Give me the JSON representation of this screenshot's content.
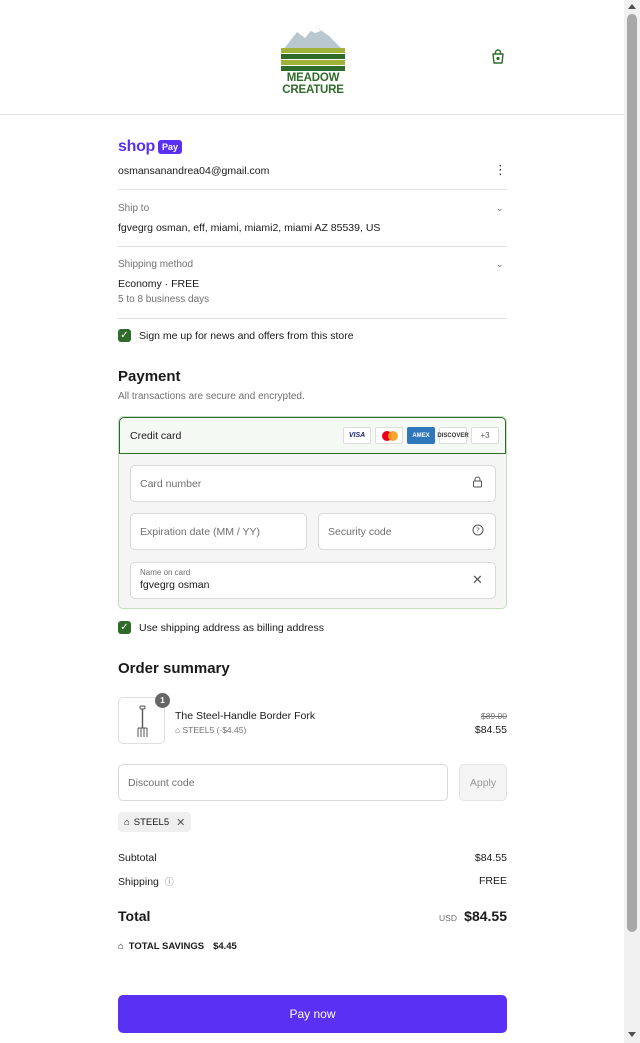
{
  "brand": {
    "name_line1": "MEADOW",
    "name_line2": "CREATURE",
    "logo_icon": "mountain-field-logo",
    "green": "#2f6b2a"
  },
  "header": {
    "cart_icon": "shopping-bag-icon"
  },
  "shop_pay": {
    "word": "shop",
    "badge": "Pay",
    "color": "#5a31f4"
  },
  "account": {
    "email": "osmansanandrea04@gmail.com",
    "menu_icon": "more-vertical-icon"
  },
  "ship_to": {
    "label": "Ship to",
    "value": "fgvegrg osman, eff, miami, miami2, miami AZ 85539, US"
  },
  "shipping_method": {
    "label": "Shipping method",
    "value": "Economy · FREE",
    "sub": "5 to 8 business days"
  },
  "newsletter": {
    "label": "Sign me up for news and offers from this store",
    "checked": true
  },
  "payment": {
    "title": "Payment",
    "subtitle": "All transactions are secure and encrypted.",
    "method_label": "Credit card",
    "card_brands": [
      "VISA",
      "AMEX",
      "DISCOVER"
    ],
    "more_brands": "+3",
    "card_number_placeholder": "Card number",
    "expiry_placeholder": "Expiration date (MM / YY)",
    "security_placeholder": "Security code",
    "name_label": "Name on card",
    "name_value": "fgvegrg osman"
  },
  "billing": {
    "label": "Use shipping address as billing address",
    "checked": true
  },
  "order_summary": {
    "title": "Order summary",
    "item": {
      "quantity": "1",
      "name": "The Steel-Handle Border Fork",
      "discount": "STEEL5 (-$4.45)",
      "old_price": "$89.00",
      "price": "$84.55"
    },
    "discount_placeholder": "Discount code",
    "apply_label": "Apply",
    "applied_code": "STEEL5",
    "subtotal_label": "Subtotal",
    "subtotal_value": "$84.55",
    "shipping_label": "Shipping",
    "shipping_value": "FREE",
    "total_label": "Total",
    "total_currency": "USD",
    "total_value": "$84.55",
    "savings_label": "TOTAL SAVINGS",
    "savings_value": "$4.45"
  },
  "pay_button": {
    "label": "Pay now"
  }
}
